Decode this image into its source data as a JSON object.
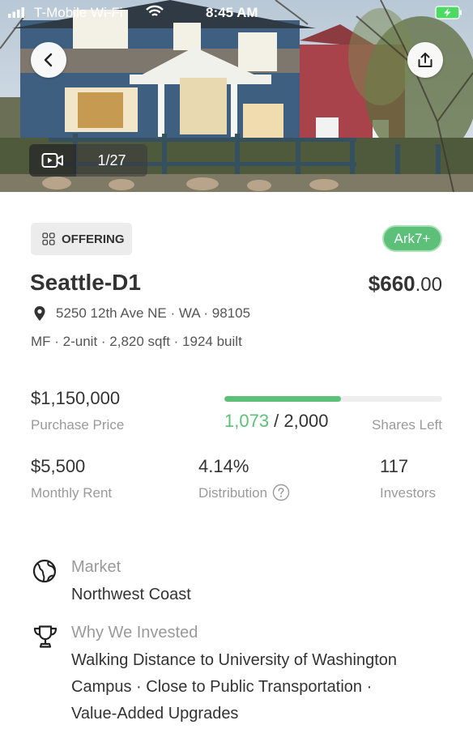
{
  "status_bar": {
    "carrier": "T-Mobile Wi-Fi",
    "time": "8:45 AM"
  },
  "gallery": {
    "photo_count": "1/27"
  },
  "listing": {
    "status_chip": "OFFERING",
    "badge": "Ark7+",
    "name": "Seattle-D1",
    "price_dollars": "$660",
    "price_cents": ".00",
    "address": "5250 12th Ave NE · WA · 98105",
    "details": "MF · 2-unit · 2,820 sqft · 1924 built"
  },
  "stats": {
    "purchase_price": {
      "value": "$1,150,000",
      "label": "Purchase Price"
    },
    "shares": {
      "sold": "1,073",
      "separator": " / ",
      "total": "2,000",
      "label": "Shares Left",
      "progress_fraction": 0.5365
    },
    "monthly_rent": {
      "value": "$5,500",
      "label": "Monthly Rent"
    },
    "distribution": {
      "value": "4.14%",
      "label": "Distribution"
    },
    "investors": {
      "value": "117",
      "label": "Investors"
    }
  },
  "info": {
    "market": {
      "label": "Market",
      "value": "Northwest Coast"
    },
    "why": {
      "label": "Why We Invested",
      "lines": [
        "Walking Distance to University of Washington",
        "Campus · Close to Public Transportation ·",
        "Value-Added Upgrades"
      ]
    }
  },
  "colors": {
    "accent_green": "#5cc078",
    "text_primary": "#333333",
    "text_muted": "#9a9a9a"
  }
}
